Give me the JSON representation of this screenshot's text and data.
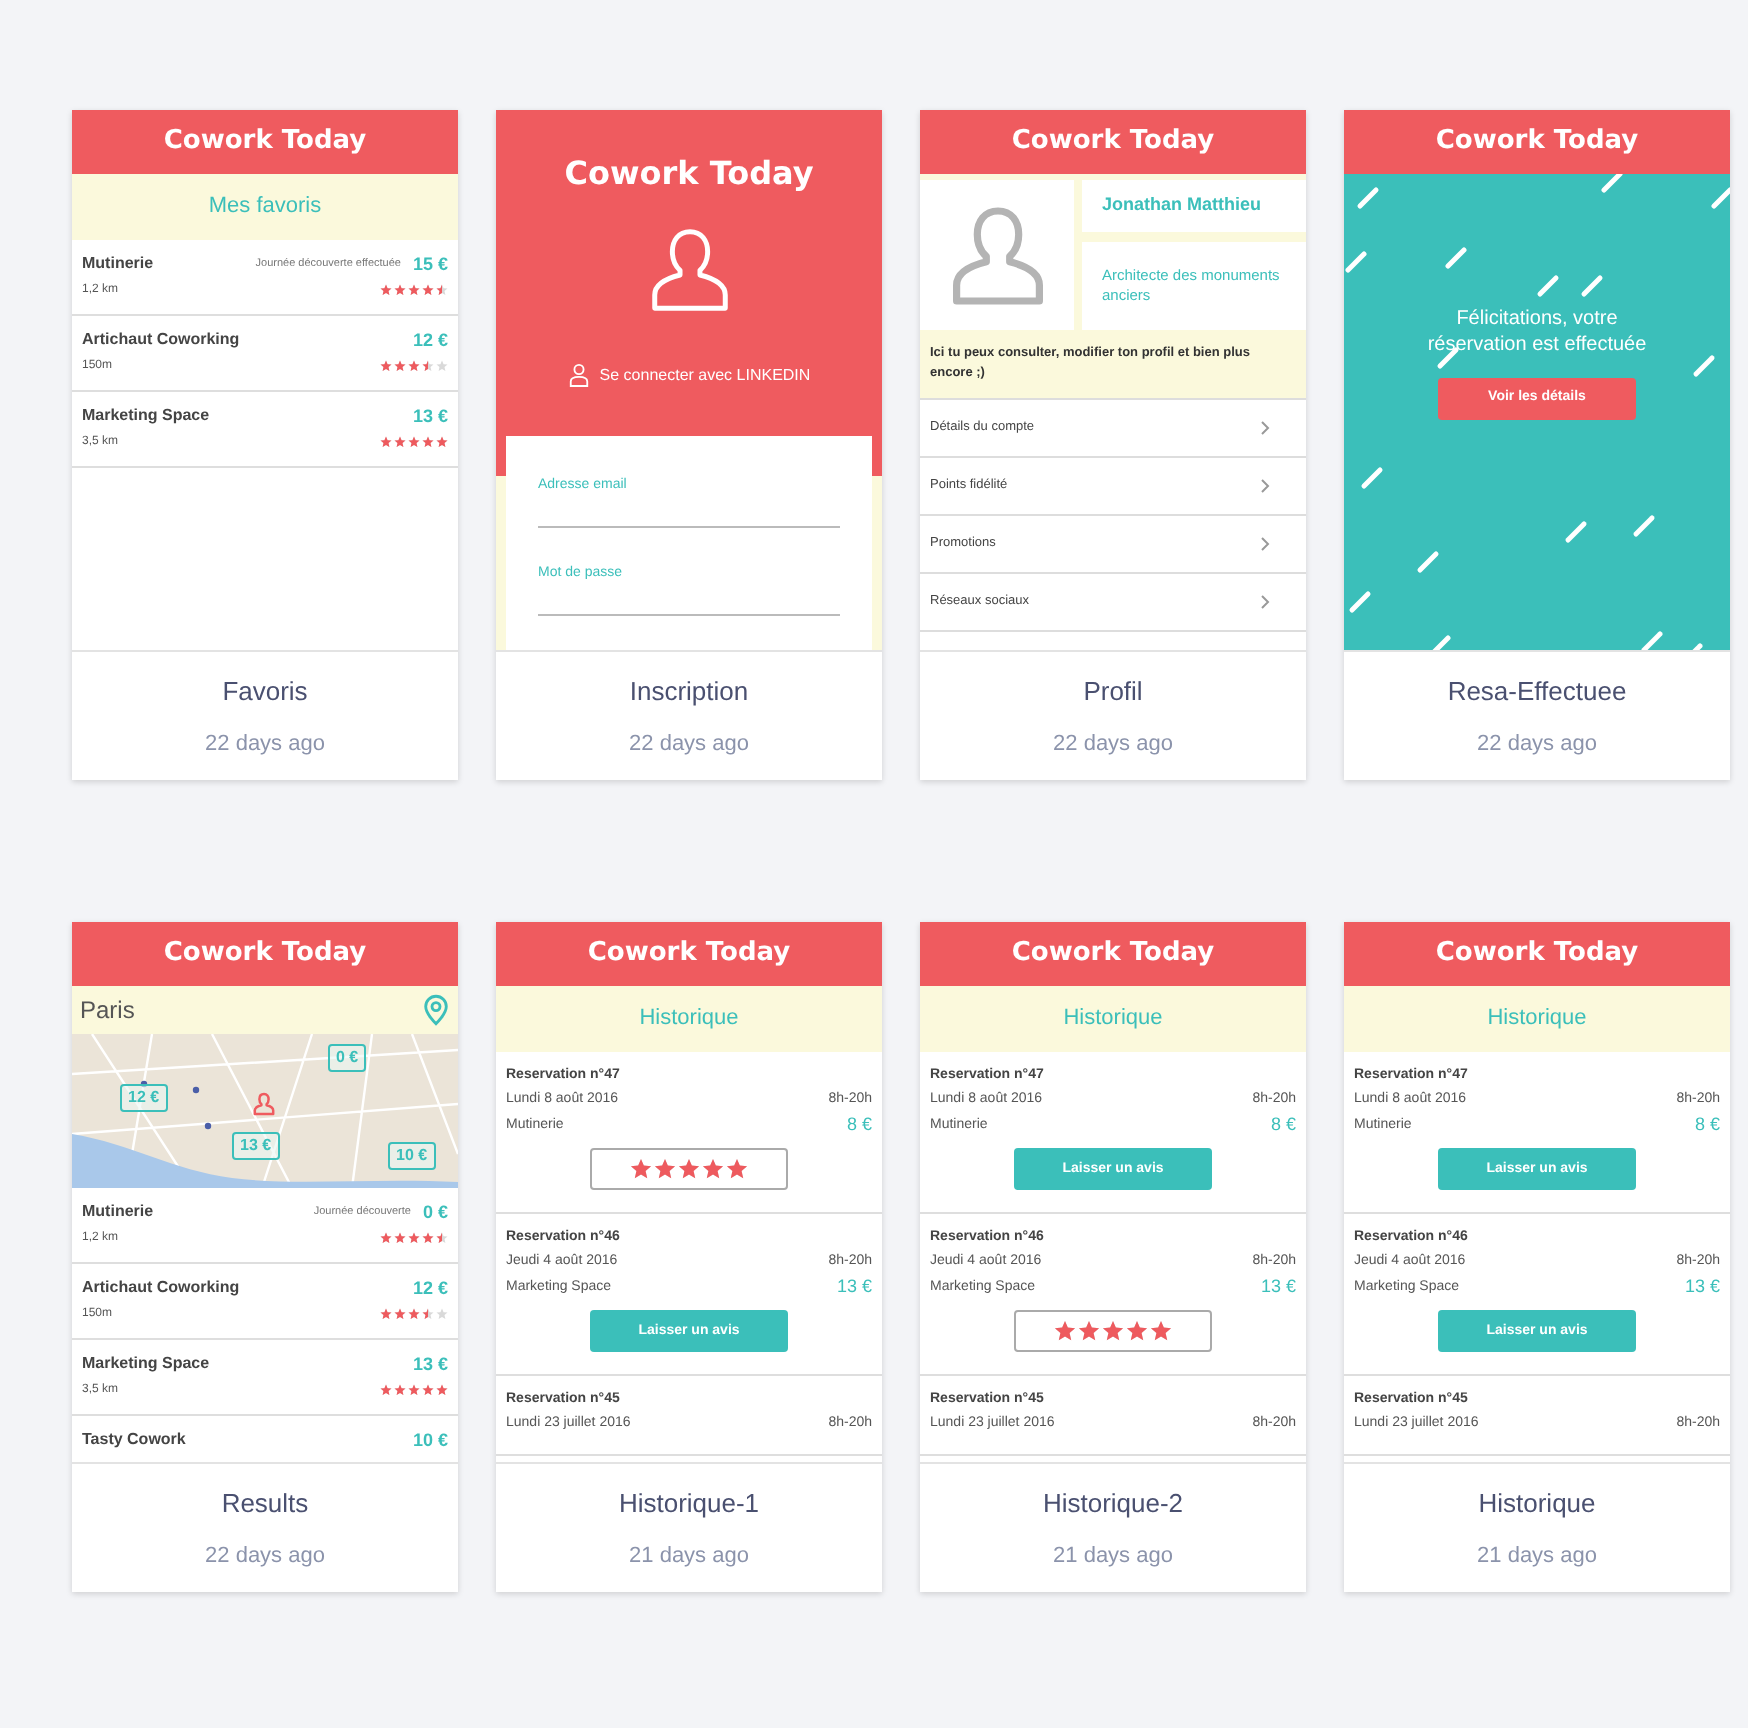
{
  "cards": [
    {
      "kind": "favorites",
      "app_title": "Cowork Today",
      "subtitle": "Mes favoris",
      "places": [
        {
          "name": "Mutinerie",
          "distance": "1,2 km",
          "note": "Journée découverte effectuée",
          "price": "15 €",
          "stars": 4.5
        },
        {
          "name": "Artichaut Coworking",
          "distance": "150m",
          "price": "12 €",
          "stars": 3.5
        },
        {
          "name": "Marketing Space",
          "distance": "3,5 km",
          "price": "13 €",
          "stars": 5
        }
      ],
      "name": "Favoris",
      "time": "22 days ago"
    },
    {
      "kind": "signup",
      "app_title": "Cowork Today",
      "linkedin": "Se connecter avec LINKEDIN",
      "fields": [
        {
          "label": "Adresse email"
        },
        {
          "label": "Mot de passe"
        }
      ],
      "name": "Inscription",
      "time": "22 days ago"
    },
    {
      "kind": "profile",
      "app_title": "Cowork Today",
      "user_name": "Jonathan Matthieu",
      "job": "Architecte des monuments anciers",
      "description": "Ici tu peux consulter, modifier ton profil et bien plus encore ;)",
      "menu": [
        "Détails du compte",
        "Points fidélité",
        "Promotions",
        "Réseaux sociaux"
      ],
      "name": "Profil",
      "time": "22 days ago"
    },
    {
      "kind": "confirmation",
      "app_title": "Cowork Today",
      "message": "Félicitations, votre réservation est effectuée",
      "button": "Voir les détails",
      "name": "Resa-Effectuee",
      "time": "22 days ago"
    },
    {
      "kind": "results",
      "app_title": "Cowork Today",
      "location": "Paris",
      "markers": [
        "0 €",
        "12 €",
        "13 €",
        "10 €"
      ],
      "places": [
        {
          "name": "Mutinerie",
          "distance": "1,2 km",
          "note": "Journée découverte",
          "price": "0 €",
          "stars": 4.5
        },
        {
          "name": "Artichaut Coworking",
          "distance": "150m",
          "price": "12 €",
          "stars": 3.5
        },
        {
          "name": "Marketing Space",
          "distance": "3,5 km",
          "price": "13 €",
          "stars": 5
        },
        {
          "name": "Tasty Cowork",
          "price": "10 €"
        }
      ],
      "name": "Results",
      "time": "22 days ago"
    },
    {
      "kind": "history",
      "app_title": "Cowork Today",
      "subtitle": "Historique",
      "reservations": [
        {
          "title": "Reservation n°47",
          "date": "Lundi 8 août 2016",
          "hours": "8h-20h",
          "place": "Mutinerie",
          "price": "8 €",
          "kind": "rating",
          "stars": 5
        },
        {
          "title": "Reservation n°46",
          "date": "Jeudi 4 août 2016",
          "hours": "8h-20h",
          "place": "Marketing Space",
          "price": "13 €",
          "kind": "button",
          "button": "Laisser un avis"
        },
        {
          "title": "Reservation n°45",
          "date": "Lundi 23 juillet 2016",
          "hours": "8h-20h"
        }
      ],
      "name": "Historique-1",
      "time": "21 days ago"
    },
    {
      "kind": "history",
      "app_title": "Cowork Today",
      "subtitle": "Historique",
      "reservations": [
        {
          "title": "Reservation n°47",
          "date": "Lundi 8 août 2016",
          "hours": "8h-20h",
          "place": "Mutinerie",
          "price": "8 €",
          "kind": "button",
          "button": "Laisser un avis"
        },
        {
          "title": "Reservation n°46",
          "date": "Jeudi 4 août 2016",
          "hours": "8h-20h",
          "place": "Marketing Space",
          "price": "13 €",
          "kind": "rating",
          "stars": 5
        },
        {
          "title": "Reservation n°45",
          "date": "Lundi 23 juillet 2016",
          "hours": "8h-20h"
        }
      ],
      "name": "Historique-2",
      "time": "21 days ago"
    },
    {
      "kind": "history",
      "app_title": "Cowork Today",
      "subtitle": "Historique",
      "reservations": [
        {
          "title": "Reservation n°47",
          "date": "Lundi 8 août 2016",
          "hours": "8h-20h",
          "place": "Mutinerie",
          "price": "8 €",
          "kind": "button",
          "button": "Laisser un avis"
        },
        {
          "title": "Reservation n°46",
          "date": "Jeudi 4 août 2016",
          "hours": "8h-20h",
          "place": "Marketing Space",
          "price": "13 €",
          "kind": "button",
          "button": "Laisser un avis"
        },
        {
          "title": "Reservation n°45",
          "date": "Lundi 23 juillet 2016",
          "hours": "8h-20h"
        }
      ],
      "name": "Historique",
      "time": "21 days ago"
    }
  ]
}
